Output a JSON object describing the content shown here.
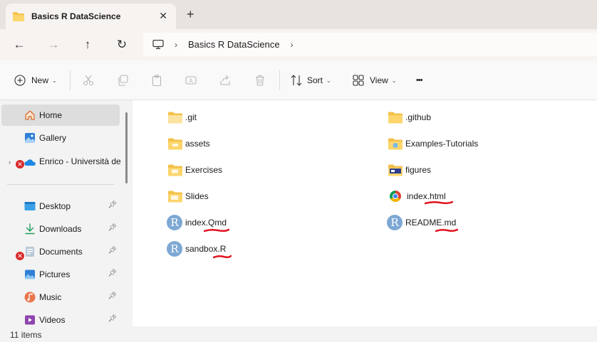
{
  "window": {
    "tab_title": "Basics R DataScience",
    "close_glyph": "✕",
    "new_tab_glyph": "+"
  },
  "nav": {
    "back_glyph": "←",
    "forward_glyph": "→",
    "up_glyph": "↑",
    "refresh_glyph": "↻",
    "chevron_glyph": "›",
    "breadcrumb": "Basics R DataScience"
  },
  "toolbar": {
    "new_label": "New",
    "sort_label": "Sort",
    "view_label": "View",
    "more_glyph": "•••",
    "caret_glyph": "⌄"
  },
  "sidebar": {
    "items": [
      {
        "label": "Home",
        "icon": "home-icon"
      },
      {
        "label": "Gallery",
        "icon": "gallery-icon"
      },
      {
        "label": "Enrico - Università de",
        "icon": "onedrive-icon"
      },
      {
        "label": "Desktop",
        "icon": "desktop-icon"
      },
      {
        "label": "Downloads",
        "icon": "downloads-icon"
      },
      {
        "label": "Documents",
        "icon": "documents-icon"
      },
      {
        "label": "Pictures",
        "icon": "pictures-icon"
      },
      {
        "label": "Music",
        "icon": "music-icon"
      },
      {
        "label": "Videos",
        "icon": "videos-icon"
      }
    ],
    "pin_glyph": "📌",
    "error_glyph": "✕",
    "expand_glyph": "›"
  },
  "files": {
    "left": [
      {
        "name": ".git",
        "icon": "folder-icon"
      },
      {
        "name": "assets",
        "icon": "folder-icon"
      },
      {
        "name": "Exercises",
        "icon": "folder-icon"
      },
      {
        "name": "Slides",
        "icon": "folder-icon"
      },
      {
        "name": "index.Qmd",
        "icon": "r-file-icon"
      },
      {
        "name": "sandbox.R",
        "icon": "r-file-icon"
      }
    ],
    "right": [
      {
        "name": ".github",
        "icon": "folder-icon"
      },
      {
        "name": "Examples-Tutorials",
        "icon": "folder-icon"
      },
      {
        "name": "figures",
        "icon": "folder-icon"
      },
      {
        "name": "index.html",
        "icon": "chrome-icon"
      },
      {
        "name": "README.md",
        "icon": "r-file-icon"
      }
    ],
    "r_glyph": "R"
  },
  "status": {
    "item_count": "11 items"
  },
  "colors": {
    "accent": "#0067c0",
    "folder": "#f8d775",
    "annotation": "#e0141e"
  }
}
